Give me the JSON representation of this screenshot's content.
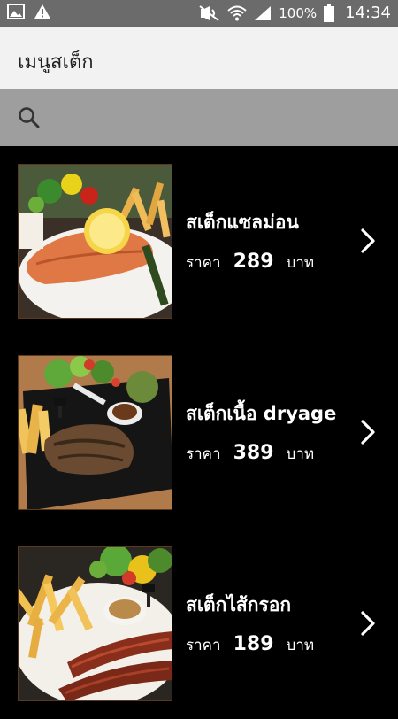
{
  "status_bar": {
    "battery": "100%",
    "time": "14:34",
    "icons": [
      "gallery-icon",
      "warning-icon",
      "mute-icon",
      "wifi-icon",
      "signal-icon",
      "battery-icon"
    ]
  },
  "appbar": {
    "title": "เมนูสเต็ก"
  },
  "search": {
    "placeholder": "",
    "value": ""
  },
  "items": [
    {
      "name": "สเต็กแซลม่อน",
      "price_label": "ราคา",
      "price": "289",
      "unit": "บาท"
    },
    {
      "name": "สเต็กเนื้อ dryage",
      "price_label": "ราคา",
      "price": "389",
      "unit": "บาท"
    },
    {
      "name": "สเต็กไส้กรอก",
      "price_label": "ราคา",
      "price": "189",
      "unit": "บาท"
    }
  ],
  "colors": {
    "status_bar": "#6b6b6b",
    "appbar": "#f2f2f2",
    "search_bar": "#9e9e9e",
    "list_bg": "#000000"
  }
}
